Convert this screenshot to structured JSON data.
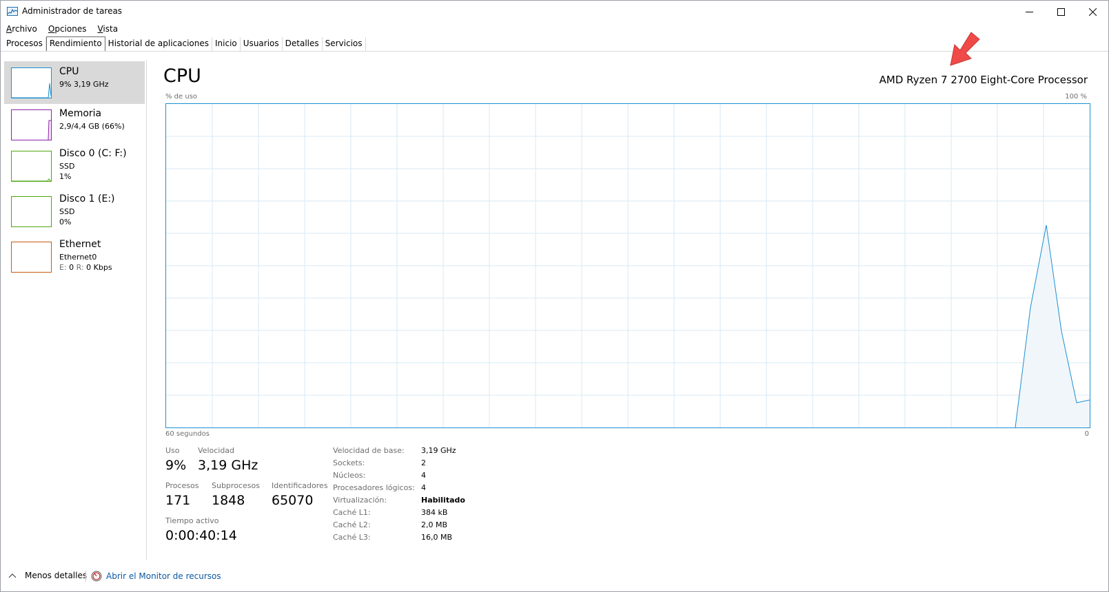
{
  "window": {
    "title": "Administrador de tareas",
    "app_icon": "task-manager-icon"
  },
  "menu": [
    "Archivo",
    "Opciones",
    "Vista"
  ],
  "tabs": [
    {
      "label": "Procesos",
      "active": false
    },
    {
      "label": "Rendimiento",
      "active": true
    },
    {
      "label": "Historial de aplicaciones",
      "active": false
    },
    {
      "label": "Inicio",
      "active": false
    },
    {
      "label": "Usuarios",
      "active": false
    },
    {
      "label": "Detalles",
      "active": false
    },
    {
      "label": "Servicios",
      "active": false
    }
  ],
  "sidebar": {
    "items": [
      {
        "name": "CPU",
        "line1": "9%  3,19 GHz",
        "line2": "",
        "color": "#1b8fd2",
        "selected": true
      },
      {
        "name": "Memoria",
        "line1": "2,9/4,4 GB (66%)",
        "line2": "",
        "color": "#8b1fa9",
        "selected": false
      },
      {
        "name": "Disco 0 (C: F:)",
        "line1": "SSD",
        "line2": "1%",
        "color": "#4da60c",
        "selected": false
      },
      {
        "name": "Disco 1 (E:)",
        "line1": "SSD",
        "line2": "0%",
        "color": "#4da60c",
        "selected": false
      },
      {
        "name": "Ethernet",
        "line1": "Ethernet0",
        "line2_e_label": "E:",
        "line2_e_value": "0",
        "line2_r_label": "R:",
        "line2_r_value": "0 Kbps",
        "color": "#c55b0e",
        "selected": false
      }
    ]
  },
  "main": {
    "title": "CPU",
    "processor": "AMD Ryzen 7 2700 Eight-Core Processor",
    "graph": {
      "y_label": "% de uso",
      "y_max_label": "100 %",
      "x_left_label": "60 segundos",
      "x_right_label": "0",
      "line_color": "#1b8fd2",
      "grid_color": "#d7eaf6"
    },
    "stats": {
      "usage_label": "Uso",
      "usage_value": "9%",
      "speed_label": "Velocidad",
      "speed_value": "3,19 GHz",
      "processes_label": "Procesos",
      "processes_value": "171",
      "threads_label": "Subprocesos",
      "threads_value": "1848",
      "handles_label": "Identificadores",
      "handles_value": "65070",
      "uptime_label": "Tiempo activo",
      "uptime_value": "0:00:40:14"
    },
    "specs": [
      {
        "label": "Velocidad de base:",
        "value": "3,19 GHz",
        "bold": false
      },
      {
        "label": "Sockets:",
        "value": "2",
        "bold": false
      },
      {
        "label": "Núcleos:",
        "value": "4",
        "bold": false
      },
      {
        "label": "Procesadores lógicos:",
        "value": "4",
        "bold": false
      },
      {
        "label": "Virtualización:",
        "value": "Habilitado",
        "bold": true
      },
      {
        "label": "Caché L1:",
        "value": "384 kB",
        "bold": false
      },
      {
        "label": "Caché L2:",
        "value": "2,0 MB",
        "bold": false
      },
      {
        "label": "Caché L3:",
        "value": "16,0 MB",
        "bold": false
      }
    ]
  },
  "footer": {
    "less_details": "Menos detalles",
    "resource_monitor": "Abrir el Monitor de recursos"
  }
}
